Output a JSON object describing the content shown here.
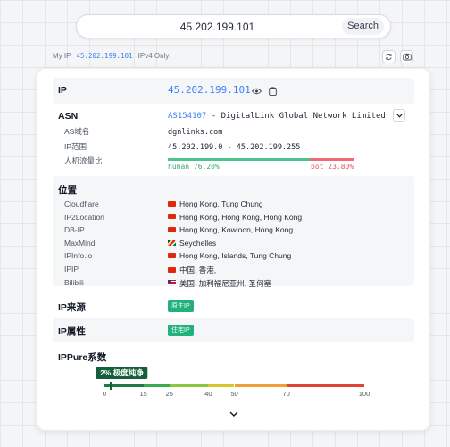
{
  "search": {
    "value": "45.202.199.101",
    "button": "Search"
  },
  "myip": {
    "label": "My IP",
    "ip": "45.202.199.101",
    "version": "IPv4 Only"
  },
  "ip_row": {
    "label": "IP",
    "value": "45.202.199.101"
  },
  "asn": {
    "label": "ASN",
    "asn": "AS154107",
    "name": " - DigitalLink Global Network Limited",
    "domain_label": "AS域名",
    "domain": "dgnlinks.com",
    "range_label": "IP范围",
    "range": "45.202.199.0 - 45.202.199.255",
    "traffic_label": "人机流量比",
    "human": "human 76.20%",
    "bot": "bot 23.80%",
    "human_fraction": 0.762
  },
  "location": {
    "label": "位置",
    "rows": [
      {
        "source": "Cloudflare",
        "flag": "hk",
        "value": "Hong Kong, Tung Chung"
      },
      {
        "source": "IP2Location",
        "flag": "hk",
        "value": "Hong Kong, Hong Kong, Hong Kong"
      },
      {
        "source": "DB-IP",
        "flag": "hk",
        "value": "Hong Kong, Kowloon, Hong Kong"
      },
      {
        "source": "MaxMind",
        "flag": "sc",
        "value": "Seychelles"
      },
      {
        "source": "IPInfo.io",
        "flag": "hk",
        "value": "Hong Kong, Islands, Tung Chung"
      },
      {
        "source": "IPIP",
        "flag": "cn",
        "value": "中国, 香港,"
      },
      {
        "source": "Bilibili",
        "flag": "us",
        "value": "美国, 加利福尼亚州, 圣何塞"
      }
    ]
  },
  "source": {
    "label": "IP来源",
    "tag": "原生IP"
  },
  "attr": {
    "label": "IP属性",
    "tag": "住宅IP"
  },
  "purity": {
    "label": "IPPure系数",
    "score_badge": "2% 极度纯净",
    "score": 2,
    "ticks": [
      "0",
      "15",
      "25",
      "40",
      "50",
      "70",
      "100"
    ]
  },
  "colors": {
    "accent": "#3b82f6",
    "human": "#4cc38a",
    "bot": "#ef6b73",
    "tag": "#22b07d"
  }
}
